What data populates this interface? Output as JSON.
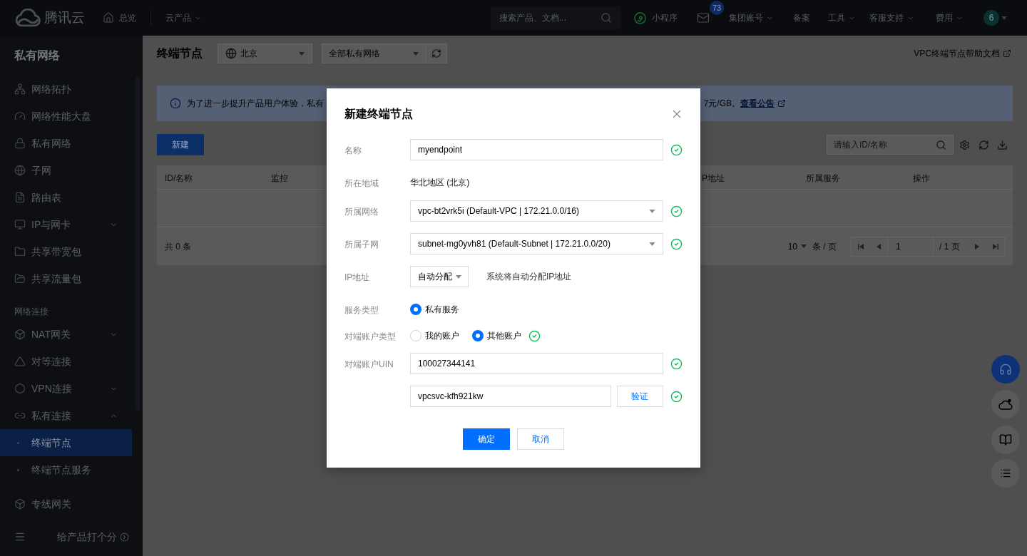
{
  "topbar": {
    "brand": "腾讯云",
    "nav": [
      {
        "label": "总览",
        "kind": "home"
      },
      {
        "label": "云产品",
        "kind": "dropdown"
      }
    ],
    "search": {
      "placeholder": "搜索产品、文档..."
    },
    "mini_program": {
      "label": "小程序"
    },
    "mail": {
      "badge": "73"
    },
    "menus": [
      {
        "label": "集团账号",
        "dropdown": true
      },
      {
        "label": "备案",
        "dropdown": false
      },
      {
        "label": "工具",
        "dropdown": true
      },
      {
        "label": "客服支持",
        "dropdown": true
      },
      {
        "label": "费用",
        "dropdown": true
      }
    ],
    "avatar": {
      "label": "6"
    }
  },
  "sidebar": {
    "title": "私有网络",
    "groups": [
      {
        "items": [
          {
            "label": "网络拓扑",
            "selected": false
          },
          {
            "label": "网络性能大盘",
            "selected": false
          },
          {
            "label": "私有网络",
            "selected": false
          },
          {
            "label": "子网",
            "selected": false
          },
          {
            "label": "路由表",
            "selected": false
          },
          {
            "label": "IP与网卡",
            "selected": false,
            "expanded": false
          },
          {
            "label": "共享带宽包",
            "selected": false
          },
          {
            "label": "共享流量包",
            "selected": false
          }
        ]
      },
      {
        "heading": "网络连接",
        "items": [
          {
            "label": "NAT网关",
            "selected": false,
            "expanded": false
          },
          {
            "label": "对等连接",
            "selected": false
          },
          {
            "label": "VPN连接",
            "selected": false,
            "expanded": false
          },
          {
            "label": "私有连接",
            "selected": false,
            "expanded": true,
            "children": [
              {
                "label": "终端节点",
                "selected": true
              },
              {
                "label": "终端节点服务",
                "selected": false
              }
            ]
          }
        ]
      },
      {
        "items": [
          {
            "label": "专线网关",
            "selected": false
          }
        ]
      }
    ],
    "footer": {
      "label": "给产品打个分"
    }
  },
  "page": {
    "title": "终端节点",
    "region_select": {
      "value": "北京"
    },
    "vpc_select": {
      "value": "全部私有网络"
    },
    "help_link": "VPC终端节点帮助文档"
  },
  "notice": {
    "text_start": "为了进一步提升产品用户体验，私有",
    "text_end": "7元/GB。",
    "link": "查看公告"
  },
  "toolbar": {
    "create_button": "新建",
    "search": {
      "placeholder": "请输入ID/名称"
    }
  },
  "table": {
    "columns": [
      "ID/名称",
      "监控",
      "P地址",
      "所属服务",
      "操作"
    ],
    "footer": {
      "total": "共 0 条",
      "page_size": "10",
      "page_size_unit": "条 / 页",
      "page": "1",
      "page_count": "/ 1 页"
    }
  },
  "modal": {
    "title": "新建终端节点",
    "fields": [
      {
        "kind": "input",
        "label": "名称",
        "value": "myendpoint",
        "valid": true
      },
      {
        "kind": "text",
        "label": "所在地域",
        "value": "华北地区 (北京)",
        "valid": false
      },
      {
        "kind": "select",
        "label": "所属网络",
        "value": "vpc-bt2vrk5i (Default-VPC | 172.21.0.0/16)",
        "valid": true
      },
      {
        "kind": "select",
        "label": "所属子网",
        "value": "subnet-mg0yvh81 (Default-Subnet | 172.21.0.0/20)",
        "valid": true
      },
      {
        "kind": "small_select",
        "label": "IP地址",
        "value": "自动分配",
        "note": "系统将自动分配IP地址",
        "valid": false
      },
      {
        "kind": "radio",
        "label": "服务类型",
        "options": [
          {
            "label": "私有服务",
            "selected": true
          }
        ],
        "valid": false
      },
      {
        "kind": "radio",
        "label": "对端账户类型",
        "options": [
          {
            "label": "我的账户",
            "selected": false
          },
          {
            "label": "其他账户",
            "selected": true
          }
        ],
        "valid": true
      },
      {
        "kind": "input",
        "label": "对端账户UIN",
        "value": "100027344141",
        "valid": true
      },
      {
        "kind": "input_button",
        "value": "vpcsvc-kfh921kw",
        "button": "验证",
        "valid": true
      }
    ],
    "buttons": [
      {
        "label": "确定",
        "kind": "primary"
      },
      {
        "label": "取消",
        "kind": "secondary"
      }
    ]
  }
}
